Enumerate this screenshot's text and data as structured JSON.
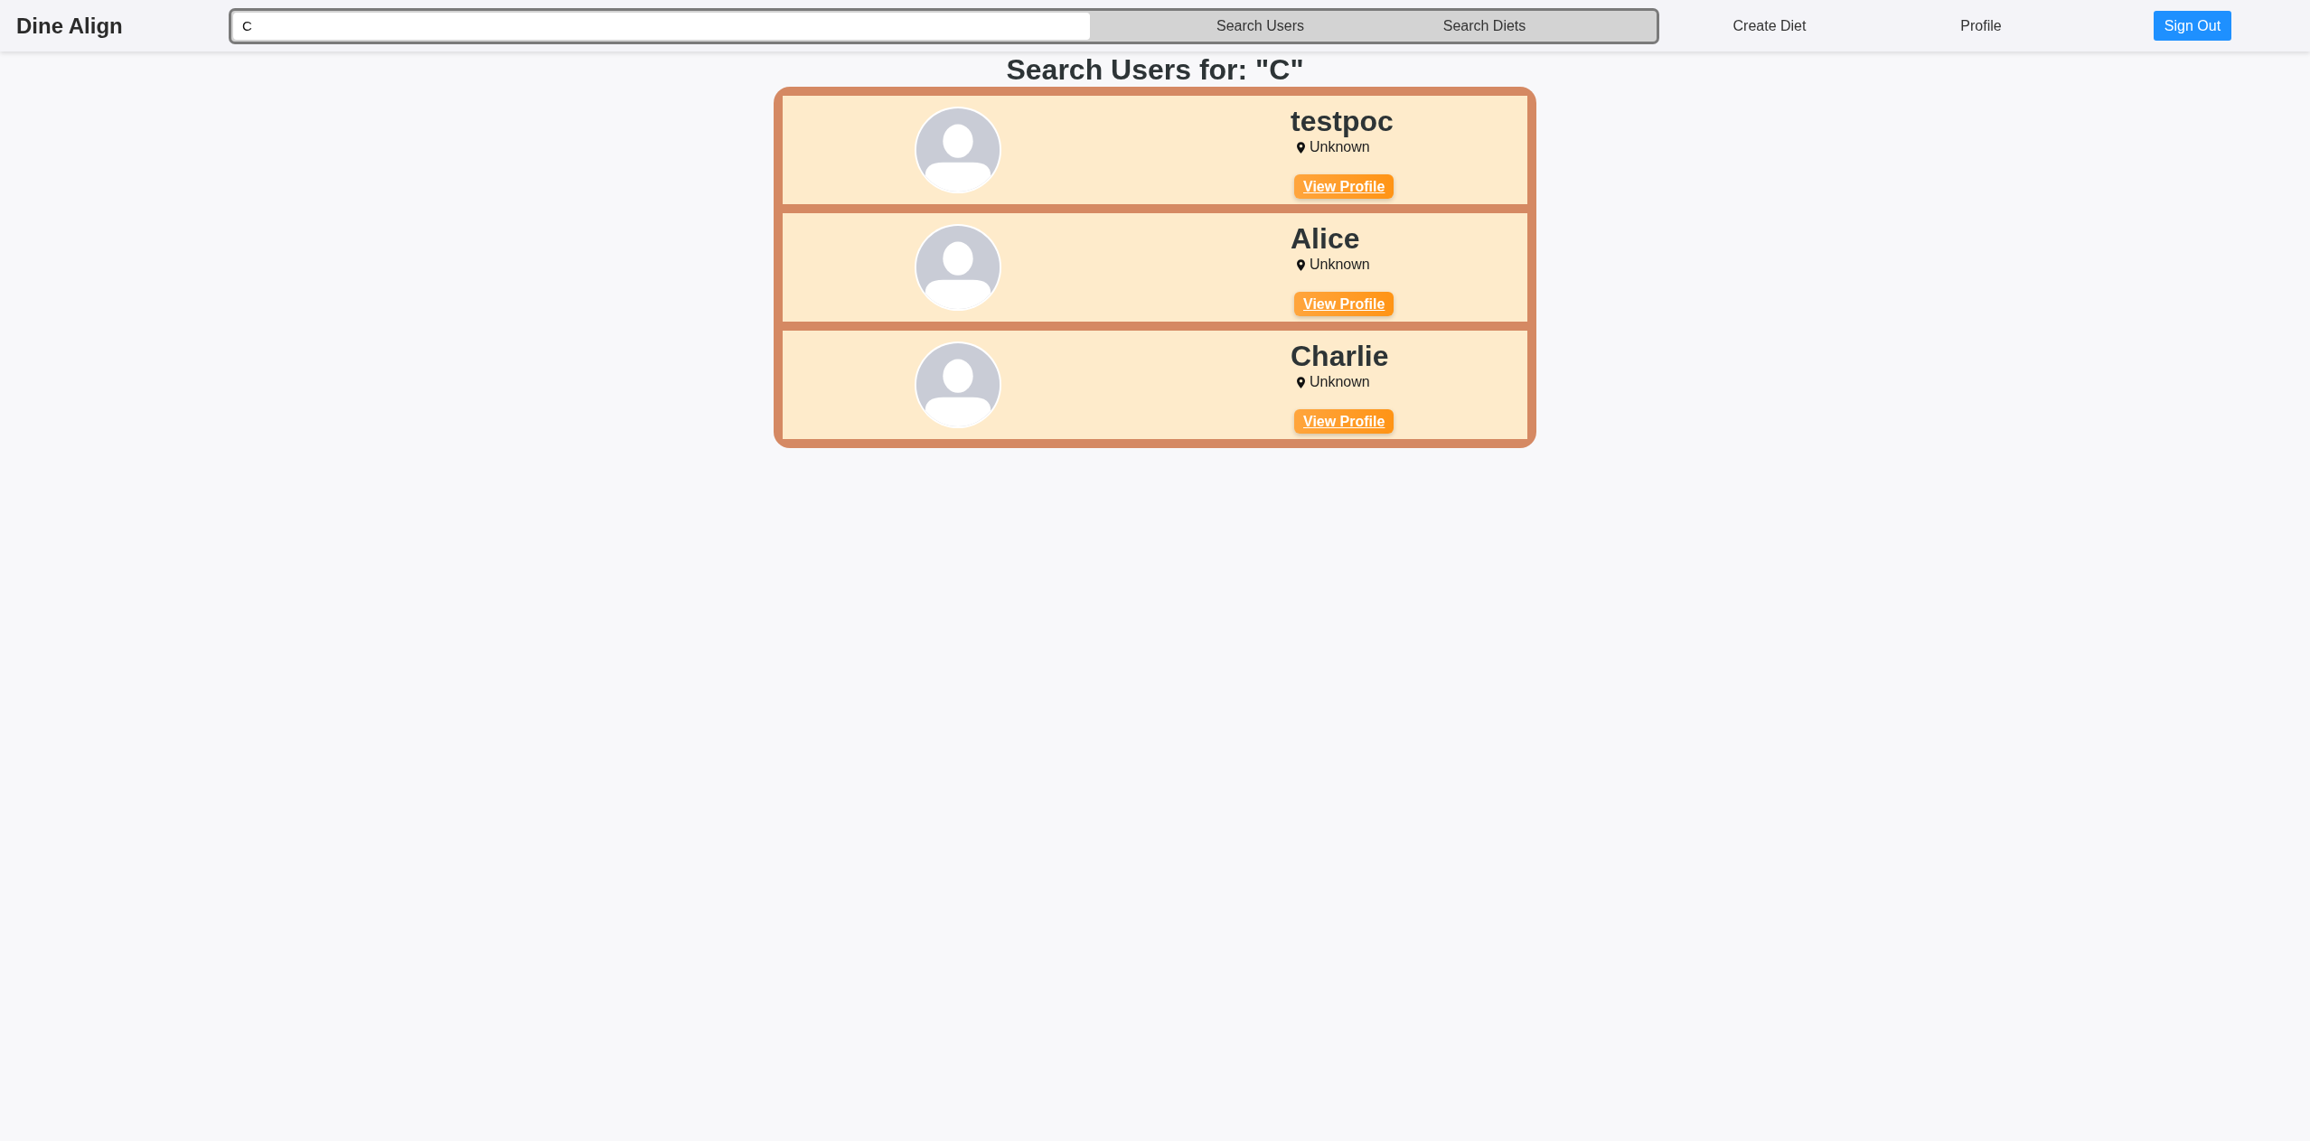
{
  "navbar": {
    "brand": "Dine Align",
    "search": {
      "value": "C",
      "buttons": [
        "Search Users",
        "Search Diets"
      ]
    },
    "links": [
      "Create Diet",
      "Profile"
    ],
    "sign_out": "Sign Out"
  },
  "heading": "Search Users for: \"C\"",
  "users": [
    {
      "name": "testpoc",
      "location": "Unknown",
      "action": "View Profile"
    },
    {
      "name": "Alice",
      "location": "Unknown",
      "action": "View Profile"
    },
    {
      "name": "Charlie",
      "location": "Unknown",
      "action": "View Profile"
    }
  ]
}
